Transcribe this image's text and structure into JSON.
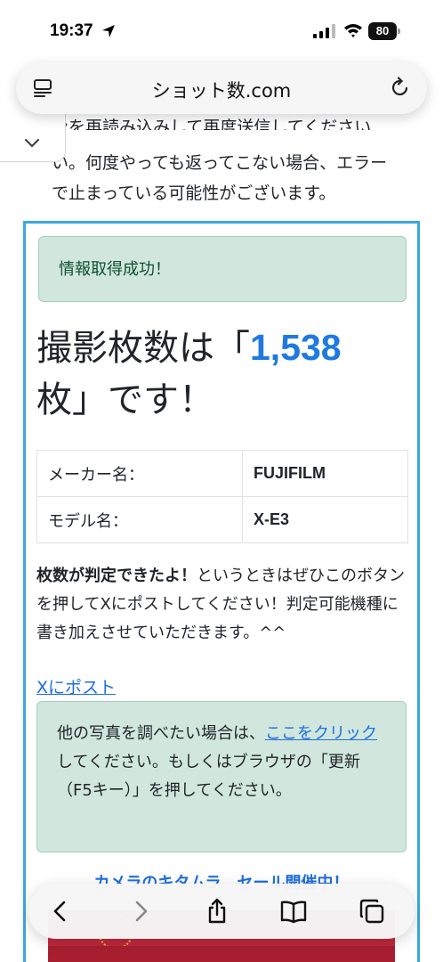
{
  "status_bar": {
    "time": "19:37",
    "battery": "80"
  },
  "browser": {
    "url": "ショット数.com"
  },
  "intro": {
    "partial_line": "ンを再読み込みして再度送信してください",
    "lines": [
      "い。何度やっても返ってこない場合、エラー",
      "で止まっている可能性がございます。"
    ]
  },
  "result": {
    "success_message": "情報取得成功！",
    "heading_prefix": "撮影枚数は「",
    "count": "1,538",
    "heading_suffix": "枚」です！",
    "table": [
      {
        "label": "メーカー名：",
        "value": "FUJIFILM"
      },
      {
        "label": "モデル名：",
        "value": "X-E3"
      }
    ],
    "post_bold": "枚数が判定できたよ！",
    "post_text": "というときはぜひこのボタンを押してXにポストしてください！判定可能機種に書き加えさせていただきます。^^",
    "x_link": "Xにポスト",
    "info_before": "他の写真を調べたい場合は、",
    "info_link": "ここをクリック",
    "info_after": "してください。もしくはブラウザの「更新（F5キー）」を押してください。",
    "sale_banner": "カメラのキタムラ　セール開催中！"
  },
  "colors": {
    "accent": "#1f7ae0",
    "link": "#1f6fe0",
    "alert_bg": "#d1e7dd",
    "box_border": "#39a9e0"
  },
  "icons": {
    "reader": "reader-mode-icon",
    "reload": "reload-icon",
    "back": "chevron-left-icon",
    "forward": "chevron-right-icon",
    "share": "share-icon",
    "bookmarks": "book-icon",
    "tabs": "tabs-icon"
  }
}
